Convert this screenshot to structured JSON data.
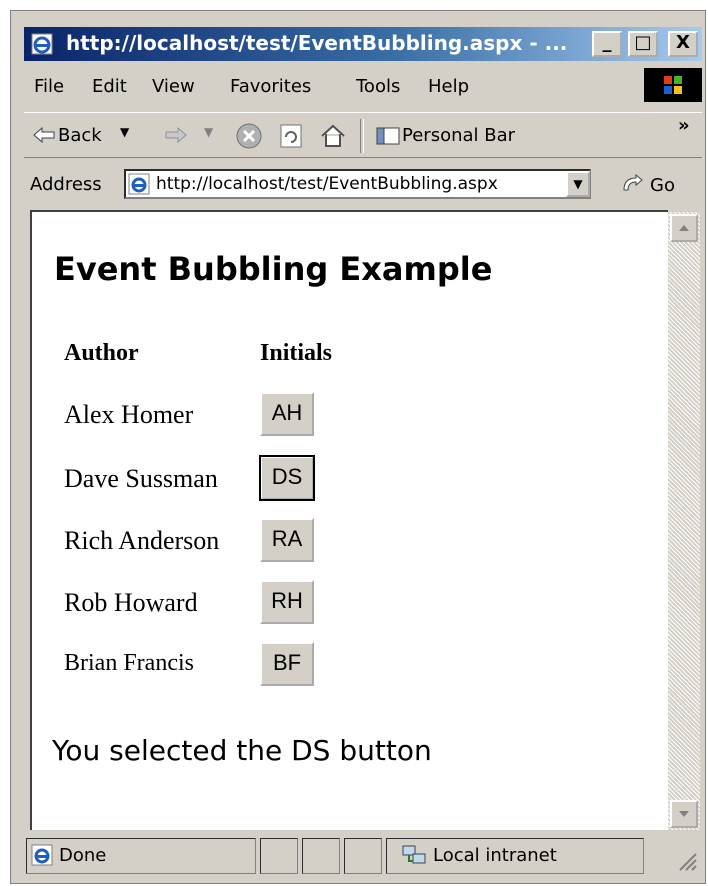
{
  "window": {
    "title": "http://localhost/test/EventBubbling.aspx - ...",
    "controls": {
      "minimize": "_",
      "maximize": "□",
      "close": "X"
    }
  },
  "menu": [
    "File",
    "Edit",
    "View",
    "Favorites",
    "Tools",
    "Help"
  ],
  "toolbar": {
    "back_label": "Back",
    "personal_bar_label": "Personal Bar",
    "overflow": "»"
  },
  "address": {
    "label": "Address",
    "value": "http://localhost/test/EventBubbling.aspx",
    "go_label": "Go"
  },
  "page": {
    "heading": "Event Bubbling Example",
    "columns": {
      "author": "Author",
      "initials": "Initials"
    },
    "authors": [
      {
        "name": "Alex Homer",
        "initials": "AH"
      },
      {
        "name": "Dave Sussman",
        "initials": "DS"
      },
      {
        "name": "Rich Anderson",
        "initials": "RA"
      },
      {
        "name": "Rob Howard",
        "initials": "RH"
      },
      {
        "name": "Brian Francis",
        "initials": "BF"
      }
    ],
    "selection_message": "You selected the DS button"
  },
  "status": {
    "text": "Done",
    "zone": "Local intranet"
  },
  "icons": [
    "ie-page-icon",
    "back-arrow-icon",
    "forward-arrow-icon",
    "stop-icon",
    "refresh-icon",
    "home-icon",
    "personal-bar-icon",
    "go-arrow-icon",
    "windows-logo-icon",
    "local-intranet-icon",
    "resize-grip-icon"
  ]
}
